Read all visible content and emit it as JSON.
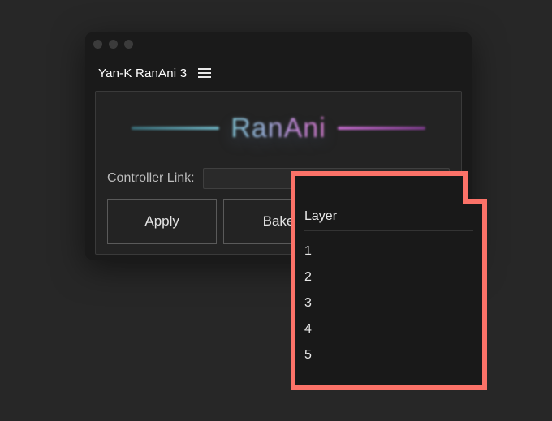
{
  "window": {
    "panel_title": "Yan-K RanAni 3",
    "logo_text": "RanAni"
  },
  "controller": {
    "label": "Controller Link:",
    "selected": ""
  },
  "buttons": {
    "apply": "Apply",
    "bake": "Bake"
  },
  "dropdown": {
    "header": "Layer",
    "items": [
      "1",
      "2",
      "3",
      "4",
      "5"
    ]
  },
  "colors": {
    "highlight": "#fb7268"
  }
}
